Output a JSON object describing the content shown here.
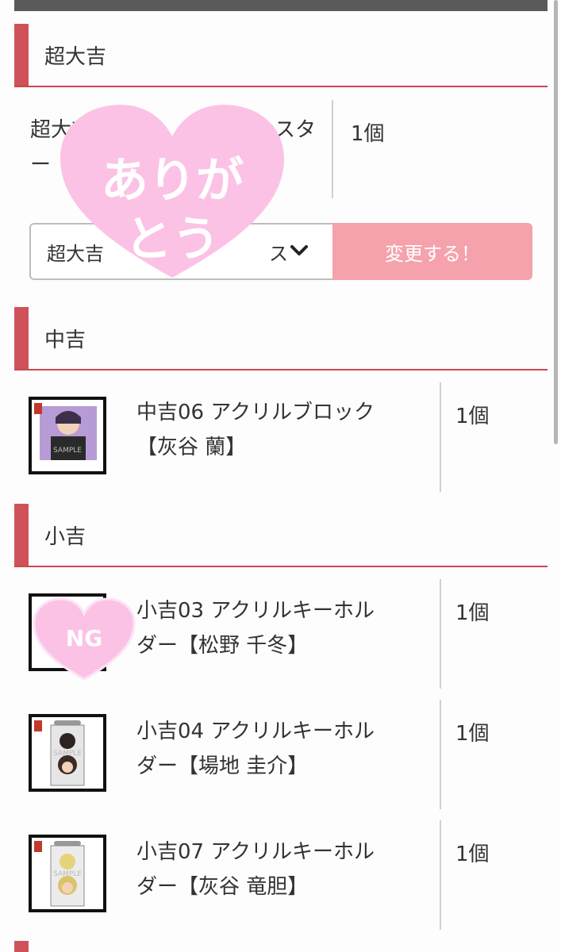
{
  "sections": {
    "s1": {
      "title": "超大吉",
      "item": {
        "name_line1": "超大吉",
        "name_line1_tail": "スタ",
        "name_line2": "ー",
        "qty": "1個"
      },
      "select_value": "超大吉",
      "select_tail": "ス",
      "change_label": "変更する！"
    },
    "s2": {
      "title": "中吉",
      "item": {
        "name_line1": "中吉06 アクリルブロック",
        "name_line2": "【灰谷 蘭】",
        "qty": "1個"
      }
    },
    "s3": {
      "title": "小吉",
      "items": [
        {
          "name_line1": "小吉03 アクリルキーホル",
          "name_line2": "ダー【松野 千冬】",
          "qty": "1個"
        },
        {
          "name_line1": "小吉04 アクリルキーホル",
          "name_line2": "ダー【場地 圭介】",
          "qty": "1個"
        },
        {
          "name_line1": "小吉07 アクリルキーホル",
          "name_line2": "ダー【灰谷 竜胆】",
          "qty": "1個"
        }
      ]
    }
  },
  "stickers": {
    "thanks_line1": "ありが",
    "thanks_line2": "とう",
    "ng": "NG"
  },
  "thumb_marks": {
    "sample": "SAMPLE"
  },
  "colors": {
    "accent": "#d05259",
    "button": "#f5a2ad",
    "sticker_pink": "#fbc2e6"
  }
}
